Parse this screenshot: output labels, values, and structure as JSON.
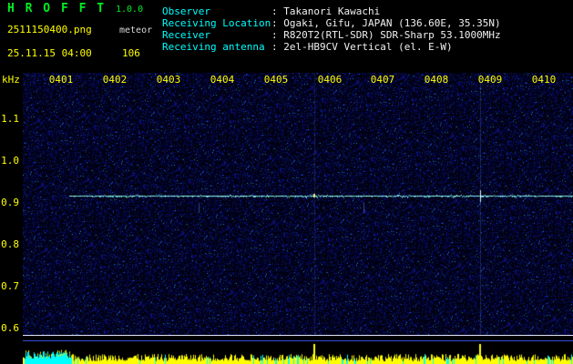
{
  "app": {
    "title": "H R O F F T",
    "version": "1.0.0",
    "filename": "2511150400.png",
    "mode": "meteor",
    "datetime": "25.11.15 04:00",
    "count": "106"
  },
  "info": {
    "rows": [
      {
        "label": "Observer",
        "value": ": Takanori Kawachi"
      },
      {
        "label": "Receiving Location",
        "value": ": Ogaki, Gifu, JAPAN (136.60E, 35.35N)"
      },
      {
        "label": "Receiver",
        "value": ": R820T2(RTL-SDR) SDR-Sharp 53.1000MHz"
      },
      {
        "label": "Receiving antenna",
        "value": ": 2el-HB9CV Vertical (el. E-W)"
      }
    ]
  },
  "axes": {
    "unit_label": "kHz",
    "freq_ticks": [
      "1.1",
      "1.0",
      "0.9",
      "0.8",
      "0.7",
      "0.6"
    ],
    "time_ticks": [
      "0401",
      "0402",
      "0403",
      "0404",
      "0405",
      "0406",
      "0407",
      "0408",
      "0409",
      "0410"
    ]
  },
  "spectrogram": {
    "background": "#000012",
    "noise_color": "#1020a0",
    "signal": {
      "freq_khz": 0.92,
      "y_frac": 0.469,
      "start_frac": 0.085,
      "color": "#b0ffe8"
    },
    "events": [
      {
        "type": "dash",
        "x_frac": 0.32
      },
      {
        "type": "dash",
        "x_frac": 0.62
      },
      {
        "type": "ping",
        "x_frac": 0.53
      },
      {
        "type": "echo",
        "x_frac": 0.831
      }
    ]
  },
  "power": {
    "bar_color": "#ffff00",
    "alt_color": "#00ffff",
    "cyan_region": [
      0.005,
      0.088
    ],
    "spikes": [
      0.53,
      0.831
    ]
  },
  "colors": {
    "title_green": "#00ee22",
    "yellow": "#ffff00",
    "cyan": "#00ffff",
    "white": "#f0f0f0"
  }
}
